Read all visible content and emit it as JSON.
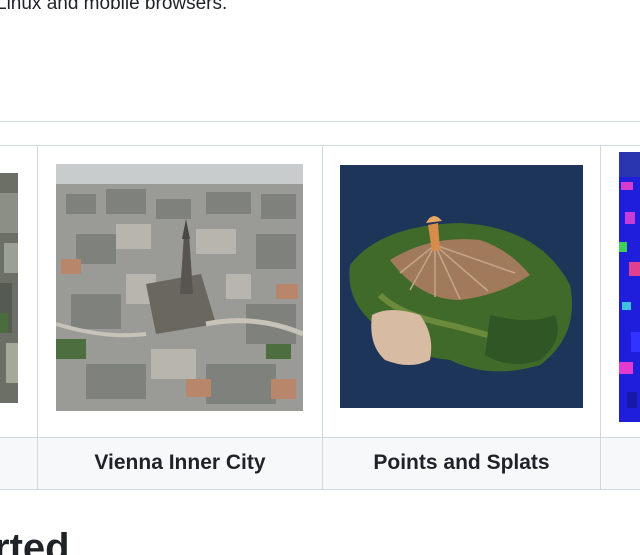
{
  "intro": {
    "text": "Linux and mobile browsers."
  },
  "gallery": {
    "items": [
      {
        "caption": "",
        "image": "aerial-city-thumbnail-partial"
      },
      {
        "caption": "Vienna Inner City",
        "image": "vienna-inner-city-aerial"
      },
      {
        "caption": "Points and Splats",
        "image": "points-and-splats-island"
      },
      {
        "caption": "",
        "image": "colored-point-cloud-partial"
      }
    ]
  },
  "next_section": {
    "heading_fragment": "rted"
  }
}
